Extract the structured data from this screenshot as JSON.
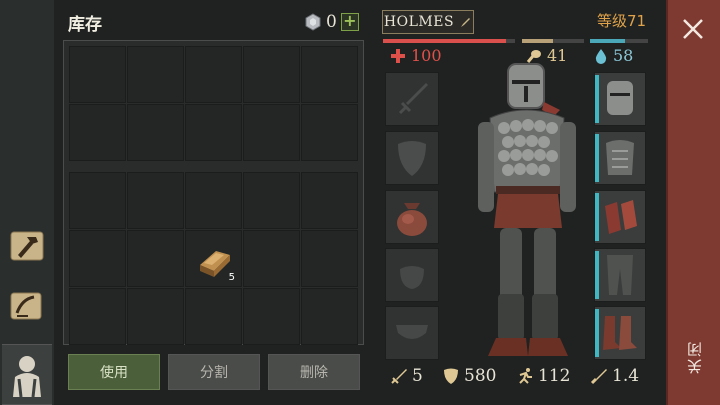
{
  "inventory": {
    "title": "库存",
    "coin_count": "0",
    "item_qty": "5",
    "buttons": {
      "use": "使用",
      "split": "分割",
      "delete": "删除"
    }
  },
  "character": {
    "name": "HOLMES",
    "level": "等级71",
    "health": "100",
    "food": "41",
    "water": "58",
    "health_fraction": 0.93,
    "food_fraction": 0.5,
    "water_fraction": 0.6,
    "stats": {
      "attack": "5",
      "defense": "580",
      "speed": "112",
      "weight": "1.4"
    }
  },
  "close_label": "关闭",
  "colors": {
    "accent_red": "#7e3a31",
    "health": "#e0504a",
    "water": "#3fb8c4",
    "level": "#e0a24a",
    "use_button": "#4a5f3a"
  },
  "icons": [
    "crafting-hammer-icon",
    "quest-scroll-icon",
    "character-icon",
    "coin-icon",
    "plus-icon",
    "edit-pen-icon",
    "health-cross-icon",
    "food-drumstick-icon",
    "water-drop-icon",
    "sword-icon",
    "shield-icon",
    "bag-icon",
    "helmet-icon",
    "body-armor-icon",
    "gloves-icon",
    "pants-icon",
    "boots-icon",
    "close-icon"
  ]
}
